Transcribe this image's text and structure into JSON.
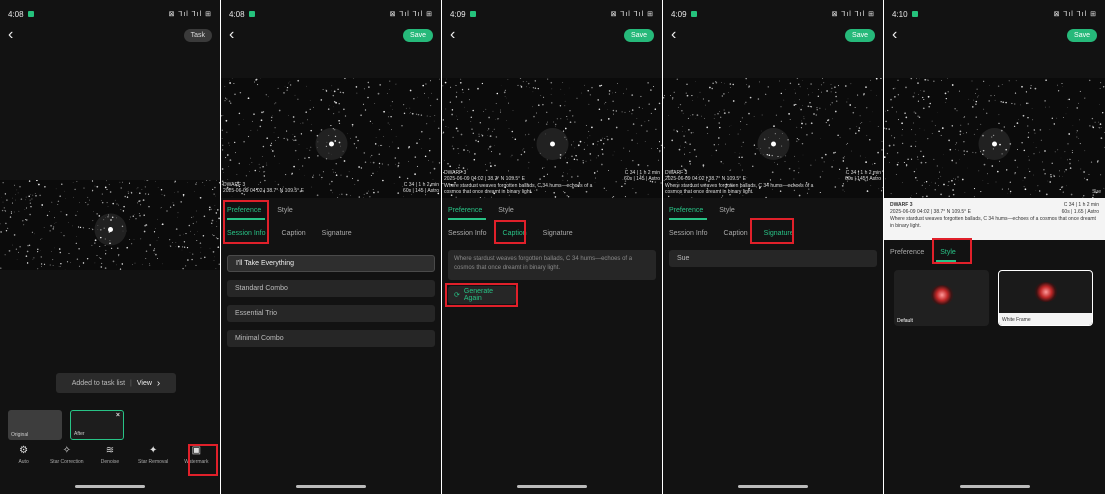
{
  "screens": [
    {
      "status": {
        "time": "4:08",
        "icons": "⊠ ⅂ıl ⅂ıl ⊞"
      },
      "top_right": "Task",
      "toast": {
        "text": "Added to task list",
        "link": "View"
      },
      "thumbs": [
        "Original",
        "After"
      ],
      "tools": [
        "Auto",
        "Star Correction",
        "Denoise",
        "Star Removal",
        "Watermark"
      ]
    },
    {
      "status": {
        "time": "4:08",
        "icons": "⊠ ⅂ıl ⅂ıl ⊞"
      },
      "top_right": "Save",
      "watermark": {
        "name": "DWARF 3",
        "meta": "2025-06-09 04:02 | 38.7° N 109.5° E",
        "exposure": "C 34 | 1 h 2 min",
        "details": "60s | 145 | Astro"
      },
      "tabs_main": [
        "Preference",
        "Style"
      ],
      "tabs_sub": [
        "Session Info",
        "Caption",
        "Signature"
      ],
      "presets": [
        "I'll Take Everything",
        "Standard Combo",
        "Essential Trio",
        "Minimal Combo"
      ]
    },
    {
      "status": {
        "time": "4:09",
        "icons": "⊠ ⅂ıl ⅂ıl ⊞"
      },
      "top_right": "Save",
      "watermark": {
        "name": "DWARF 3",
        "meta": "2025-06-09 04:02 | 38.7° N 109.5° E",
        "caption": "Where stardust weaves forgotten ballads, C 34 hums—echoes of a cosmos that once dreamt in binary light.",
        "exposure": "C 34 | 1 h 2 min",
        "details": "60s | 145 | Astro"
      },
      "tabs_main": [
        "Preference",
        "Style"
      ],
      "tabs_sub": [
        "Session Info",
        "Caption",
        "Signature"
      ],
      "caption_text": "Where stardust weaves forgotten ballads, C 34 hums—echoes of a cosmos that once dreamt in binary light.",
      "generate_label": "Generate Again"
    },
    {
      "status": {
        "time": "4:09",
        "icons": "⊠ ⅂ıl ⅂ıl ⊞"
      },
      "top_right": "Save",
      "watermark": {
        "name": "DWARF 3",
        "meta": "2025-06-09 04:02 | 38.7° N 109.5° E",
        "caption": "Where stardust weaves forgotten ballads, C 34 hums—echoes of a cosmos that once dreamt in binary light.",
        "exposure": "C 34 | 1 h 2 min",
        "details": "60s | 145 | Astro"
      },
      "tabs_main": [
        "Preference",
        "Style"
      ],
      "tabs_sub": [
        "Session Info",
        "Caption",
        "Signature"
      ],
      "signature_value": "Sue"
    },
    {
      "status": {
        "time": "4:10",
        "icons": "⊠ ⅂ıl ⅂ıl ⊞"
      },
      "top_right": "Save",
      "photo_sig": "Sue",
      "watermark": {
        "name": "DWARF 3",
        "meta": "2025-06-09 04:02 | 38.7° N 109.5° E",
        "caption": "Where stardust weaves forgotten ballads, C 34 hums—echoes of a cosmos that once dreamt in binary light.",
        "exposure": "C 34 | 1 h 2 min",
        "details": "60s | 1.65 | Astro"
      },
      "tabs_main": [
        "Preference",
        "Style"
      ],
      "styles": [
        "Default",
        "White Frame"
      ]
    }
  ],
  "colors": {
    "accent": "#28c386",
    "highlight": "#e0202a",
    "background": "#121212"
  }
}
